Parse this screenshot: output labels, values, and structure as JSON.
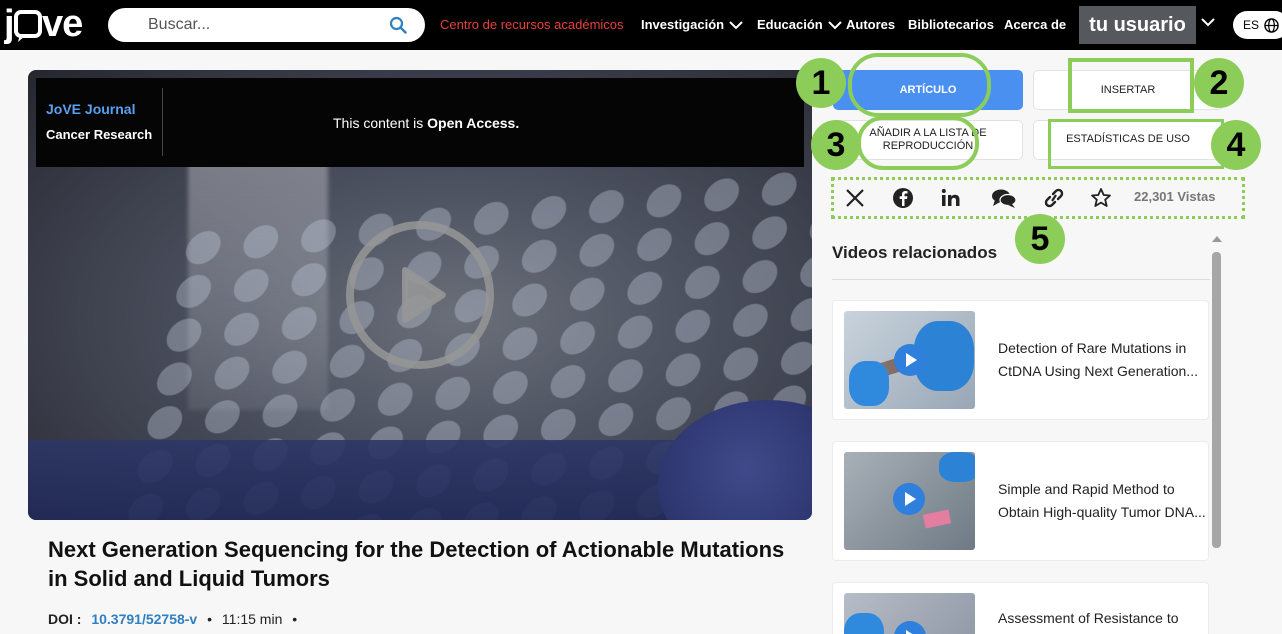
{
  "nav": {
    "logo_text": "jove",
    "search_placeholder": "Buscar...",
    "links": {
      "resources": "Centro de recursos académicos",
      "research": "Investigación",
      "education": "Educación",
      "authors": "Autores",
      "librarians": "Bibliotecarios",
      "about": "Acerca de"
    },
    "user": "tu usuario",
    "lang": "ES"
  },
  "video": {
    "journal": "JoVE Journal",
    "section": "Cancer Research",
    "access_prefix": "This content is ",
    "access_bold": "Open Access."
  },
  "article": {
    "title": "Next Generation Sequencing for the Detection of Actionable Mutations in Solid and Liquid Tumors",
    "doi_label": "DOI :",
    "doi": "10.3791/52758-v",
    "sep": "•",
    "duration": "11:15 min",
    "sep2": "•"
  },
  "actions": {
    "article": "ARTÍCULO",
    "embed": "INSERTAR",
    "add_playlist": "AÑADIR A LA LISTA DE REPRODUCCIÓN",
    "usage_stats": "ESTADÍSTICAS DE USO"
  },
  "badges": [
    "1",
    "2",
    "3",
    "4",
    "5"
  ],
  "social": {
    "icons": [
      "x-icon",
      "facebook-icon",
      "linkedin-icon",
      "chat-icon",
      "link-icon",
      "star-icon"
    ],
    "views": "22,301 Vistas"
  },
  "related": {
    "heading": "Videos relacionados",
    "items": [
      {
        "title": "Detection of Rare Mutations in CtDNA Using Next Generation..."
      },
      {
        "title": "Simple and Rapid Method to Obtain High-quality Tumor DNA..."
      },
      {
        "title": "Assessment of Resistance to"
      }
    ]
  },
  "colors": {
    "accent_blue": "#4a90f0",
    "highlight_green": "#8ccd5a",
    "nav_red": "#e8403b"
  }
}
